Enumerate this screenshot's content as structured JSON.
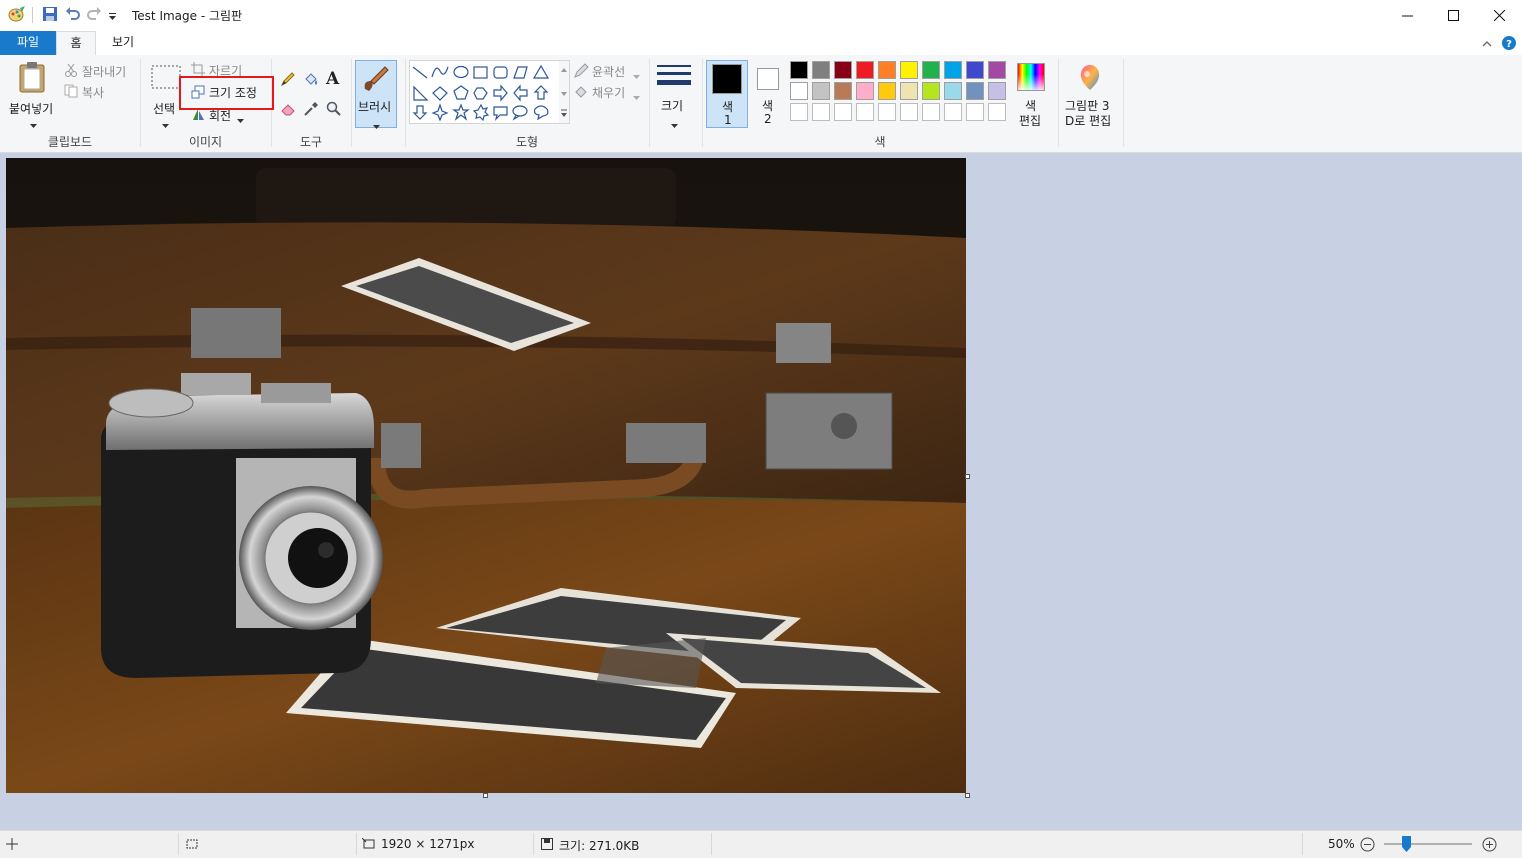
{
  "window": {
    "title": "Test Image - 그림판",
    "minimize_label": "—",
    "maximize_label": "☐",
    "close_label": "✕"
  },
  "tabs": [
    {
      "label": "파일"
    },
    {
      "label": "홈"
    },
    {
      "label": "보기"
    }
  ],
  "ribbon": {
    "clipboard": {
      "paste_label": "붙여넣기",
      "cut_label": "잘라내기",
      "copy_label": "복사",
      "group_label": "클립보드"
    },
    "image": {
      "select_label": "선택",
      "crop_label": "자르기",
      "resize_label": "크기 조정",
      "rotate_label": "회전",
      "group_label": "이미지"
    },
    "tools": {
      "group_label": "도구"
    },
    "brush": {
      "label": "브러시"
    },
    "shapes": {
      "outline_label": "윤곽선",
      "fill_label": "채우기",
      "group_label": "도형"
    },
    "size": {
      "label": "크기"
    },
    "colors": {
      "color1_label": "색",
      "color1_num": "1",
      "color2_label": "색",
      "color2_num": "2",
      "edit_colors_line1": "색",
      "edit_colors_line2": "편집",
      "group_label": "색",
      "color1_value": "#000000",
      "color2_value": "#ffffff",
      "palette_row1": [
        "#000000",
        "#7f7f7f",
        "#880015",
        "#ed1c24",
        "#ff7f27",
        "#fff200",
        "#22b14c",
        "#00a2e8",
        "#3f48cc",
        "#a349a4"
      ],
      "palette_row2": [
        "#ffffff",
        "#c3c3c3",
        "#b97a57",
        "#ffaec9",
        "#ffc90e",
        "#efe4b0",
        "#b5e61d",
        "#99d9ea",
        "#7092be",
        "#c8bfe7"
      ]
    },
    "paint3d": {
      "line1": "그림판 3",
      "line2": "D로 편집"
    }
  },
  "status": {
    "dimensions": "1920 × 1271px",
    "file_size": "크기: 271.0KB",
    "zoom": "50%",
    "zoom_fraction": 0.5
  }
}
